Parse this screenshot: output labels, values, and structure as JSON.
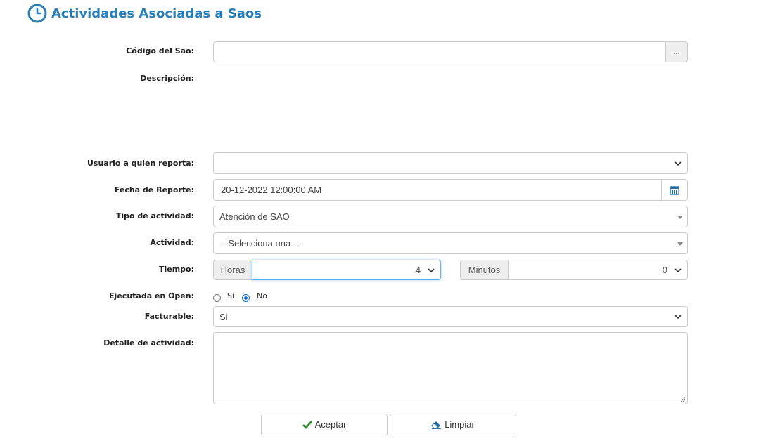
{
  "page": {
    "title": "Actividades Asociadas a Saos"
  },
  "form": {
    "codigo": {
      "label": "Código del Sao:",
      "value": "",
      "browse_label": "..."
    },
    "descripcion": {
      "label": "Descripción:"
    },
    "usuario": {
      "label": "Usuario a quien reporta:",
      "value": ""
    },
    "fecha": {
      "label": "Fecha de Reporte:",
      "value": "20-12-2022 12:00:00 AM"
    },
    "tipo": {
      "label": "Tipo de actividad:",
      "value": "Atención de SAO"
    },
    "actividad": {
      "label": "Actividad:",
      "value": "-- Selecciona una --"
    },
    "tiempo": {
      "label": "Tiempo:",
      "horas_label": "Horas",
      "horas_value": "4",
      "minutos_label": "Minutos",
      "minutos_value": "0"
    },
    "open": {
      "label": "Ejecutada en Open:",
      "options": [
        "Sí",
        "No"
      ],
      "selected": "No"
    },
    "facturable": {
      "label": "Facturable:",
      "value": "Si"
    },
    "detalle": {
      "label": "Detalle de actividad:",
      "value": ""
    }
  },
  "buttons": {
    "accept": "Aceptar",
    "clear": "Limpiar"
  },
  "colors": {
    "accent": "#2a7fb8",
    "check": "#2e8b2e",
    "focus": "#66afe9"
  }
}
